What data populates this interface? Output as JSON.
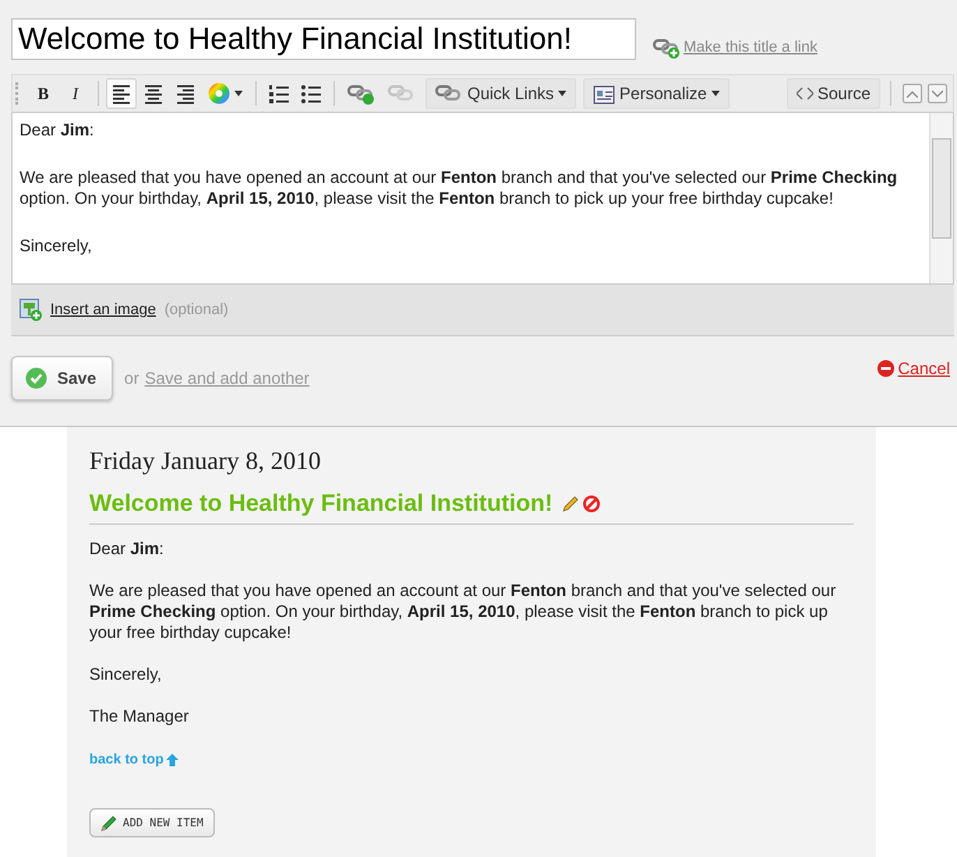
{
  "editor_panel": {
    "title_field": {
      "value": "Welcome to Healthy Financial Institution!"
    },
    "title_link": "Make this title a link",
    "toolbar": [
      {
        "kind": "bold",
        "label": "B"
      },
      {
        "kind": "italic",
        "label": "I"
      },
      {
        "kind": "separator"
      },
      {
        "kind": "align-left",
        "selected": true
      },
      {
        "kind": "align-center",
        "selected": false
      },
      {
        "kind": "align-right",
        "selected": false
      },
      {
        "kind": "color"
      },
      {
        "kind": "separator"
      },
      {
        "kind": "ordered-list"
      },
      {
        "kind": "bullet-list"
      },
      {
        "kind": "separator"
      },
      {
        "kind": "link",
        "disabled": false
      },
      {
        "kind": "unlink",
        "disabled": true
      },
      {
        "kind": "dropdown",
        "label": "Quick Links"
      },
      {
        "kind": "dropdown",
        "label": "Personalize"
      },
      {
        "kind": "spacer"
      },
      {
        "kind": "source",
        "label": "Source"
      },
      {
        "kind": "separator"
      },
      {
        "kind": "expand"
      },
      {
        "kind": "collapse"
      }
    ],
    "body": [
      "Dear **Jim**:",
      "We are pleased that you have opened an account at our **Fenton** branch and that you've selected our **Prime Checking** option. On your birthday, **April 15, 2010**, please visit the **Fenton** branch to pick up your free birthday cupcake!",
      "Sincerely,"
    ],
    "insert_image": {
      "link": "Insert an image",
      "note": "(optional)"
    },
    "save_button": "Save",
    "or_text": "or",
    "save_another": "Save and add another",
    "cancel": "Cancel"
  },
  "preview": {
    "date": "Friday January 8, 2010",
    "title": "Welcome to Healthy Financial Institution!",
    "body": [
      "Dear **Jim**:",
      "We are pleased that you have opened an account at our **Fenton** branch and that you've selected our **Prime Checking** option. On your birthday, **April 15, 2010**, please visit the **Fenton** branch to pick up your free birthday cupcake!",
      "Sincerely,",
      "The Manager"
    ],
    "back_to_top": "back to top",
    "add_button": "ADD NEW ITEM"
  }
}
